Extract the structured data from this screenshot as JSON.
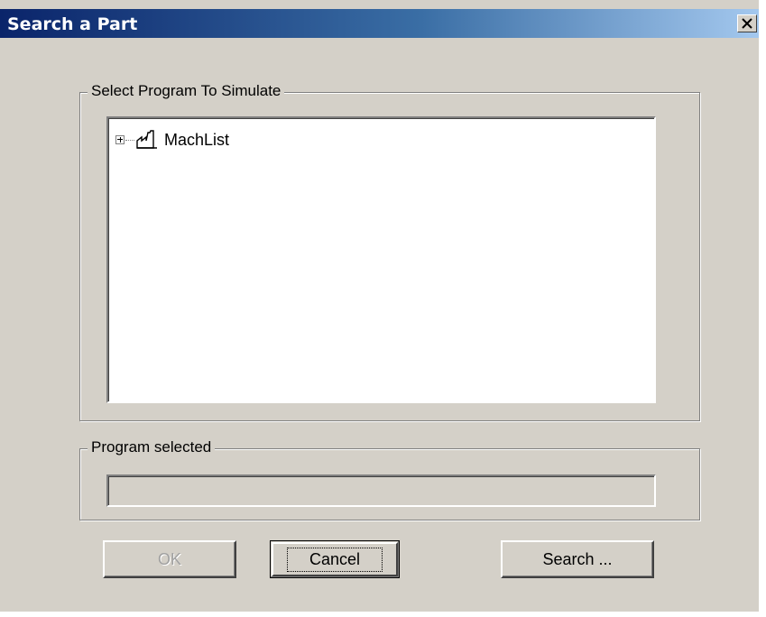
{
  "window": {
    "title": "Search a Part",
    "close_symbol": "×"
  },
  "program_group": {
    "label": "Select Program To Simulate",
    "tree": [
      {
        "label": "MachList",
        "expander": "+",
        "icon": "factory-icon"
      }
    ]
  },
  "selected_group": {
    "label": "Program selected",
    "value": ""
  },
  "buttons": {
    "ok": "OK",
    "cancel": "Cancel",
    "search": "Search ..."
  },
  "colors": {
    "face": "#d4d0c8",
    "title_start": "#0a246a",
    "title_end": "#a6caf0",
    "disabled_text": "#a0a0a0"
  }
}
